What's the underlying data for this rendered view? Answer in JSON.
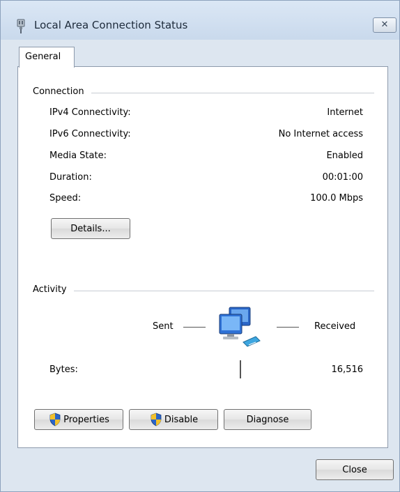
{
  "window": {
    "title": "Local Area Connection Status",
    "close_glyph": "✕"
  },
  "tabs": [
    {
      "label": "General"
    }
  ],
  "connection": {
    "group_label": "Connection",
    "rows": [
      {
        "label": "IPv4 Connectivity:",
        "value": "Internet"
      },
      {
        "label": "IPv6 Connectivity:",
        "value": "No Internet access"
      },
      {
        "label": "Media State:",
        "value": "Enabled"
      },
      {
        "label": "Duration:",
        "value": "00:01:00"
      },
      {
        "label": "Speed:",
        "value": "100.0 Mbps"
      }
    ],
    "details_button": "Details..."
  },
  "activity": {
    "group_label": "Activity",
    "sent_label": "Sent",
    "received_label": "Received",
    "bytes_label": "Bytes:",
    "bytes_received": "16,516"
  },
  "buttons": {
    "properties": "Properties",
    "disable": "Disable",
    "diagnose": "Diagnose",
    "close": "Close"
  },
  "icons": {
    "title": "network-adapter-icon",
    "activity": "network-computers-icon",
    "shield": "uac-shield-icon"
  },
  "colors": {
    "window_bg": "#dde6f0",
    "title_text": "#1d2a3a",
    "border": "#8c99ab",
    "group_line": "#c7ccd3"
  }
}
